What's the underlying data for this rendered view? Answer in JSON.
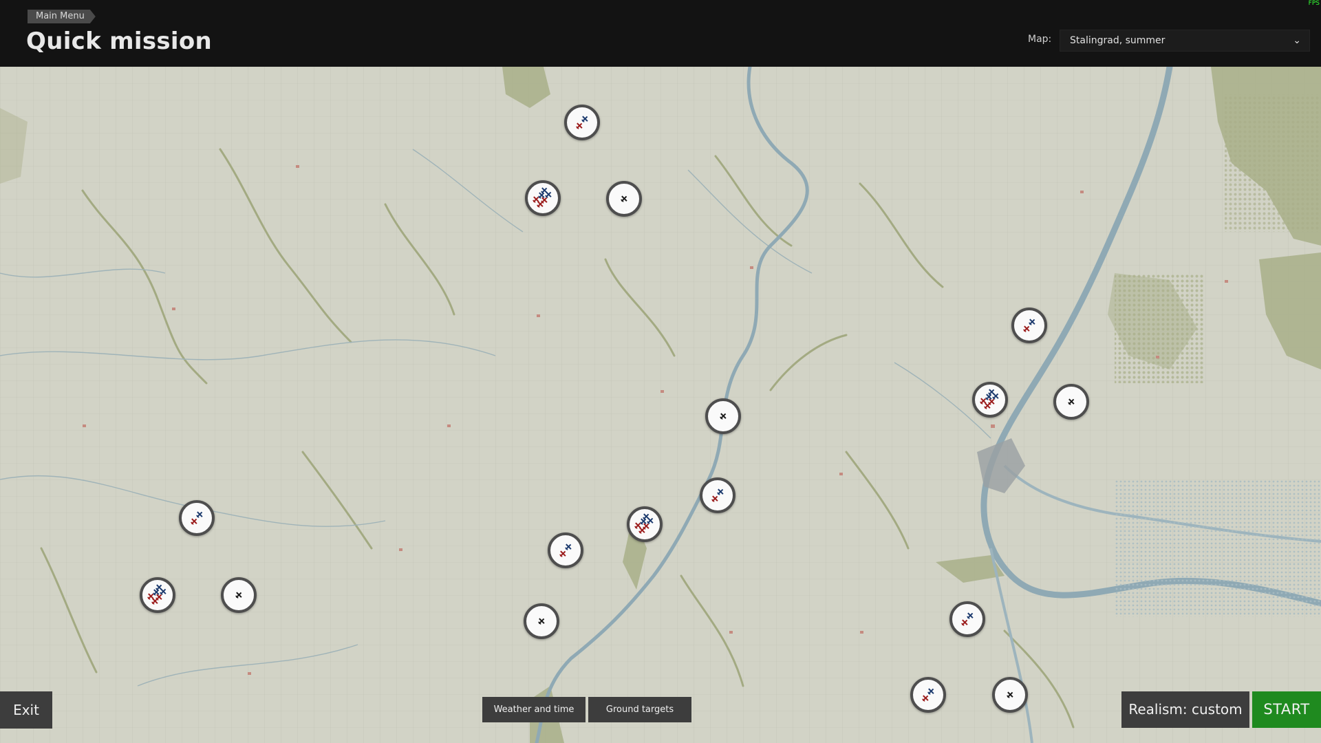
{
  "header": {
    "breadcrumb": "Main Menu",
    "title": "Quick mission",
    "map_label": "Map:",
    "map_value": "Stalingrad, summer",
    "corner_marker": "FPS"
  },
  "buttons": {
    "exit": "Exit",
    "weather": "Weather and time",
    "ground_targets": "Ground targets",
    "realism": "Realism: custom",
    "start": "START"
  },
  "colors": {
    "map_bg": "#d2d3c6",
    "river": "#8fa9b4",
    "forest": "#a6ad86",
    "allied_plane": "#1d3b6e",
    "axis_plane": "#9b1c1c",
    "neutral_plane": "#1a1a1a",
    "start_button": "#1f8a1f"
  },
  "airfields": [
    {
      "id": "af1",
      "type": "pair"
    },
    {
      "id": "af2",
      "type": "group"
    },
    {
      "id": "af3",
      "type": "single"
    },
    {
      "id": "af4",
      "type": "pair"
    },
    {
      "id": "af5",
      "type": "group"
    },
    {
      "id": "af6",
      "type": "single"
    },
    {
      "id": "af7",
      "type": "single"
    },
    {
      "id": "af8",
      "type": "pair"
    },
    {
      "id": "af9",
      "type": "pair"
    },
    {
      "id": "af10",
      "type": "group"
    },
    {
      "id": "af11",
      "type": "single"
    },
    {
      "id": "af12",
      "type": "pair"
    },
    {
      "id": "af13",
      "type": "pair"
    },
    {
      "id": "af14",
      "type": "group"
    },
    {
      "id": "af15",
      "type": "single"
    },
    {
      "id": "af16",
      "type": "single"
    },
    {
      "id": "af17",
      "type": "pair"
    },
    {
      "id": "af18",
      "type": "group"
    },
    {
      "id": "af19",
      "type": "single"
    }
  ]
}
